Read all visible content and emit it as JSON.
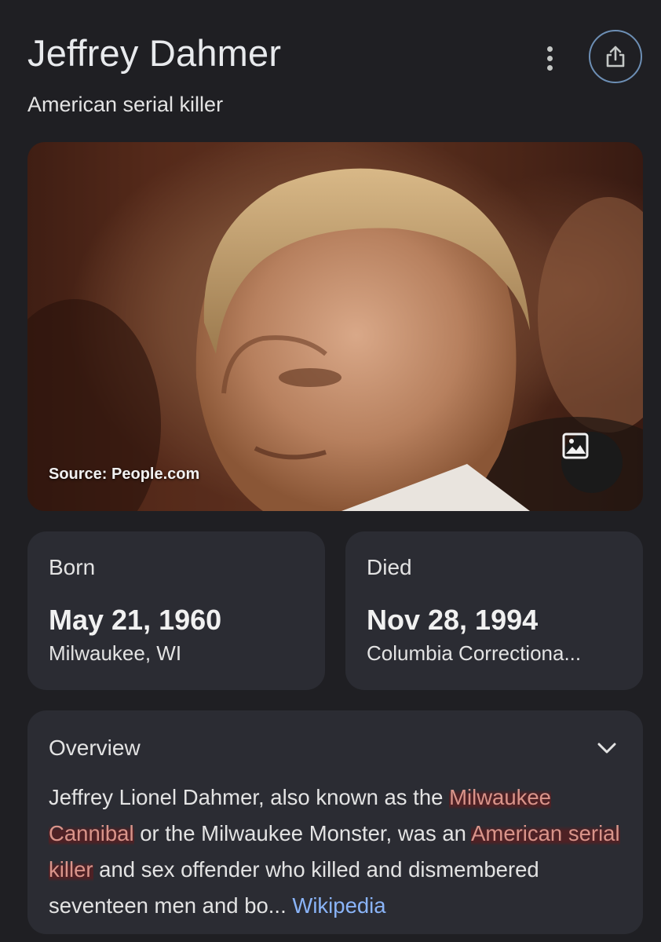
{
  "header": {
    "title": "Jeffrey Dahmer",
    "subtitle": "American serial killer",
    "more_icon": "more-vert-icon",
    "share_icon": "share-icon"
  },
  "photo": {
    "source": "Source: People.com",
    "image_icon": "image-icon"
  },
  "born": {
    "label": "Born",
    "date": "May 21, 1960",
    "place": "Milwaukee, WI"
  },
  "died": {
    "label": "Died",
    "date": "Nov 28, 1994",
    "place": "Columbia Correctiona..."
  },
  "overview": {
    "heading": "Overview",
    "chevron_icon": "chevron-down-icon",
    "text_1": "Jeffrey Lionel Dahmer, also known as the ",
    "link_1": "Milwaukee Cannibal",
    "text_2": " or the Milwaukee Monster, was an ",
    "link_2": "American serial killer",
    "text_3": " and sex offender who killed and dismembered seventeen men and bo... ",
    "source_link": "Wikipedia"
  },
  "colors": {
    "background": "#1f1f23",
    "card": "#2b2c33",
    "link_red": "#d9948a",
    "link_blue": "#8ab4f8"
  }
}
